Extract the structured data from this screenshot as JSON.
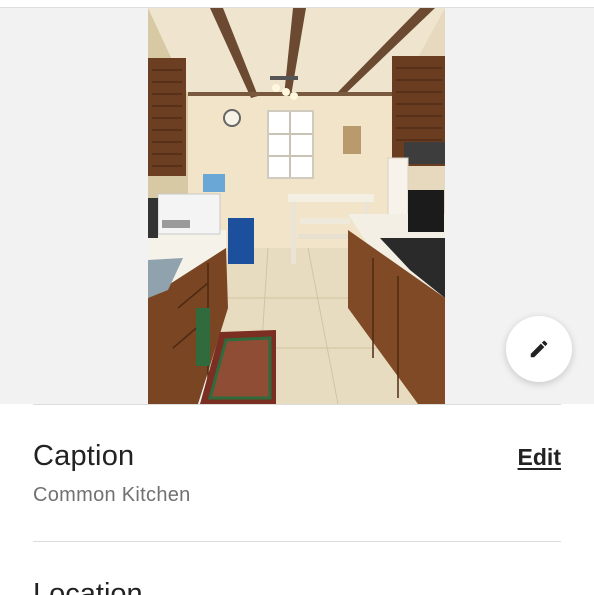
{
  "photo": {
    "subject": "kitchen",
    "edit_icon": "pencil-icon"
  },
  "caption_section": {
    "heading": "Caption",
    "edit_label": "Edit",
    "value": "Common Kitchen"
  },
  "location_section": {
    "heading": "Location"
  },
  "colors": {
    "text_primary": "#222222",
    "text_secondary": "#717171",
    "divider": "#dcdcdc",
    "photo_background": "#f2f2f2"
  }
}
